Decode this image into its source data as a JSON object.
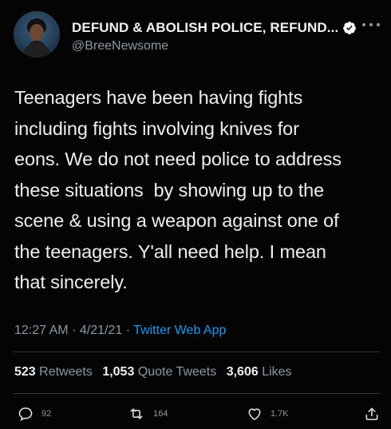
{
  "author": {
    "display_name": "DEFUND & ABOLISH POLICE, REFUND...",
    "handle": "@BreeNewsome",
    "verified": true
  },
  "tweet": {
    "text": "Teenagers have been having fights\nincluding fights involving knives for\neons. We do not need police to address\nthese situations  by showing up to the\nscene & using a weapon against one of\nthe teenagers. Y'all need help. I mean\nthat sincerely.",
    "time": "12:27 AM",
    "date": "4/21/21",
    "separator": "·",
    "source": "Twitter Web App"
  },
  "stats": {
    "retweets_count": "523",
    "retweets_label": "Retweets",
    "quotes_count": "1,053",
    "quotes_label": "Quote Tweets",
    "likes_count": "3,606",
    "likes_label": "Likes"
  },
  "actions": {
    "reply_count": "92",
    "retweet_count": "164",
    "like_count": "1.7K"
  },
  "icons": {
    "more": "more-dots-icon",
    "verified": "verified-badge-icon",
    "reply": "reply-bubble-icon",
    "retweet": "retweet-arrows-icon",
    "like": "heart-icon",
    "share": "share-upload-icon"
  },
  "colors": {
    "background": "#040404",
    "text": "#eceff1",
    "secondary": "#8b98a5",
    "link": "#1d9bf0"
  }
}
